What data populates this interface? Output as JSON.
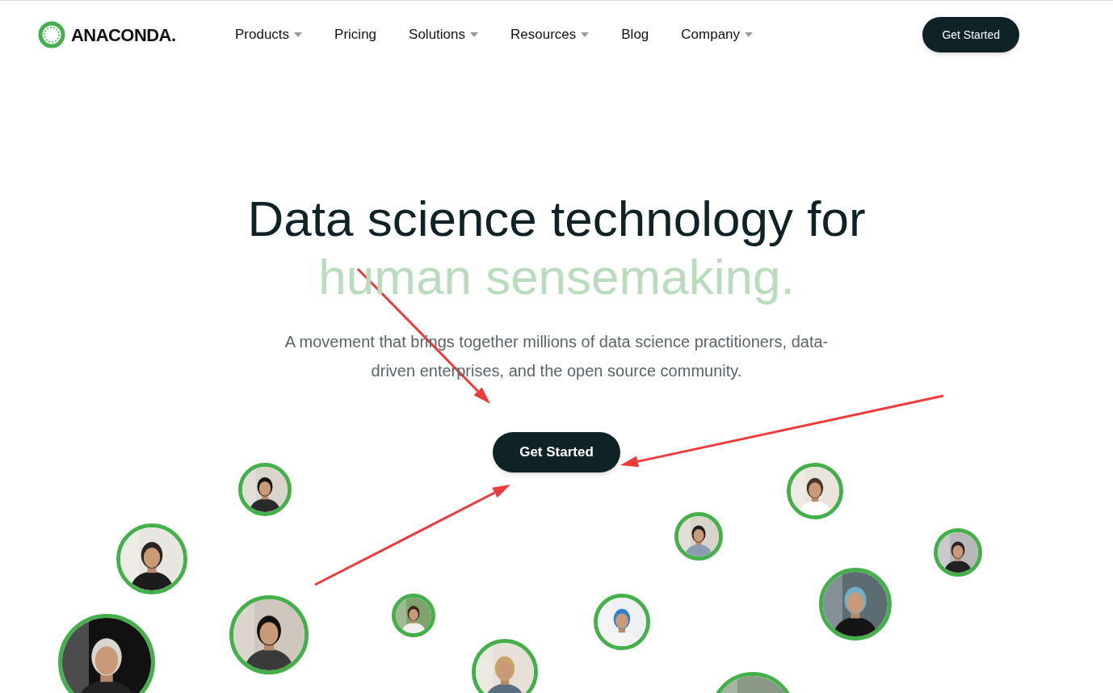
{
  "brand": {
    "name": "ANACONDA."
  },
  "nav": [
    {
      "label": "Products",
      "dropdown": true
    },
    {
      "label": "Pricing",
      "dropdown": false
    },
    {
      "label": "Solutions",
      "dropdown": true
    },
    {
      "label": "Resources",
      "dropdown": true
    },
    {
      "label": "Blog",
      "dropdown": false
    },
    {
      "label": "Company",
      "dropdown": true
    }
  ],
  "header_button": "Get Started",
  "hero": {
    "title": "Data science technology for",
    "title_accent": "human sensemaking.",
    "subtitle": "A movement that brings together millions of data science practitioners, data-driven enterprises, and the open source community.",
    "button": "Get Started"
  },
  "annotations": [
    {
      "kind": "arrow"
    },
    {
      "kind": "arrow"
    },
    {
      "kind": "arrow"
    }
  ]
}
